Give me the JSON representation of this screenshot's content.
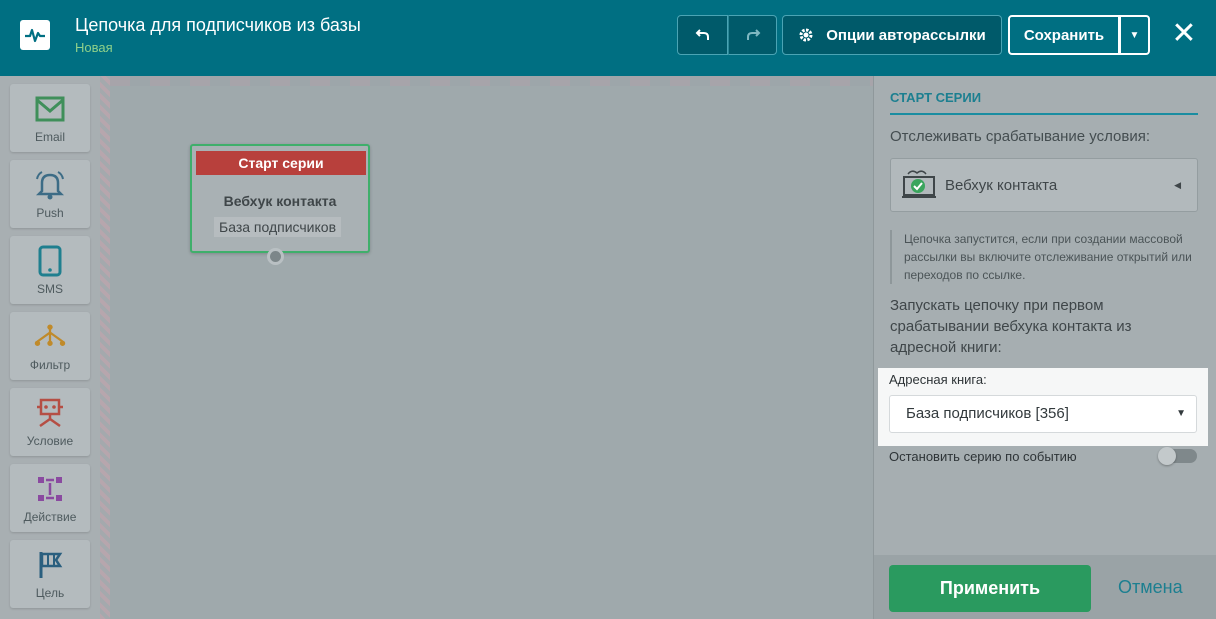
{
  "header": {
    "title": "Цепочка для подписчиков из базы",
    "status": "Новая",
    "undo_icon": "undo-icon",
    "redo_icon": "redo-icon",
    "options_label": "Опции авторассылки",
    "save_label": "Сохранить",
    "close_label": "✕"
  },
  "palette": {
    "items": [
      {
        "label": "Email",
        "icon": "mail-icon"
      },
      {
        "label": "Push",
        "icon": "bell-icon"
      },
      {
        "label": "SMS",
        "icon": "phone-icon"
      },
      {
        "label": "Фильтр",
        "icon": "filter-icon"
      },
      {
        "label": "Условие",
        "icon": "condition-icon"
      },
      {
        "label": "Действие",
        "icon": "action-icon"
      },
      {
        "label": "Цель",
        "icon": "flag-icon"
      }
    ]
  },
  "canvas": {
    "node": {
      "header": "Старт серии",
      "title": "Вебхук контакта",
      "tag": "База подписчиков"
    }
  },
  "panel": {
    "heading": "СТАРТ СЕРИИ",
    "track_label": "Отслеживать срабатывание условия:",
    "trigger_value": "Вебхук контакта",
    "note": "Цепочка запустится, если при создании массовой рассылки вы включите отслеживание открытий или переходов по ссылке.",
    "run_text": "Запускать цепочку при первом срабатывании вебхука контакта из адресной книги:",
    "addressbook_label": "Адресная книга:",
    "addressbook_value": "База подписчиков [356]",
    "stop_label": "Остановить серию по событию",
    "stop_enabled": false,
    "apply_label": "Применить",
    "cancel_label": "Отмена"
  },
  "colors": {
    "header_bg": "#006f82",
    "accent": "#1c7f90",
    "apply_green": "#2a9a5f",
    "node_header_red": "#b8403c"
  }
}
